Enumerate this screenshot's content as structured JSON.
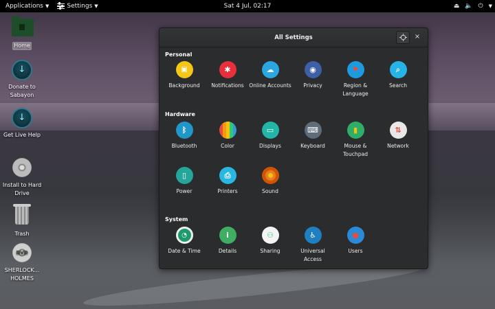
{
  "topbar": {
    "applications": "Applications",
    "settings": "Settings",
    "clock": "Sat  4 Jul, 02:17"
  },
  "desktop": [
    {
      "label": "Home",
      "icon": "folder-icon"
    },
    {
      "label": "Donate to Sabayon",
      "icon": "sabayon-icon"
    },
    {
      "label": "Get Live Help",
      "icon": "sabayon-icon"
    },
    {
      "label": "Install to Hard Drive",
      "icon": "disc-icon"
    },
    {
      "label": "Trash",
      "icon": "trash-icon"
    },
    {
      "label": "SHERLOCK... HOLMES",
      "icon": "dvd-icon"
    }
  ],
  "window": {
    "title": "All Settings",
    "close": "×"
  },
  "sections": {
    "personal": {
      "title": "Personal",
      "items": [
        {
          "label": "Background",
          "color": "#f5c518"
        },
        {
          "label": "Notifications",
          "color": "#e8303c"
        },
        {
          "label": "Online Accounts",
          "color": "#2aa6e0"
        },
        {
          "label": "Privacy",
          "color": "#3d5fa8"
        },
        {
          "label": "Region & Language",
          "color": "#1e9be0"
        },
        {
          "label": "Search",
          "color": "#27b3e8"
        }
      ]
    },
    "hardware": {
      "title": "Hardware",
      "items": [
        {
          "label": "Bluetooth",
          "color": "#2196c8"
        },
        {
          "label": "Color",
          "color": "#f0a030"
        },
        {
          "label": "Displays",
          "color": "#22b5a8"
        },
        {
          "label": "Keyboard",
          "color": "#5e6b78"
        },
        {
          "label": "Mouse & Touchpad",
          "color": "#2fae6a"
        },
        {
          "label": "Network",
          "color": "#4a90d0"
        },
        {
          "label": "Power",
          "color": "#26a69a"
        },
        {
          "label": "Printers",
          "color": "#29b6e0"
        },
        {
          "label": "Sound",
          "color": "#e67e22"
        }
      ]
    },
    "system": {
      "title": "System",
      "items": [
        {
          "label": "Date & Time",
          "color": "#1d9b6c"
        },
        {
          "label": "Details",
          "color": "#3fae63"
        },
        {
          "label": "Sharing",
          "color": "#f4f4f4"
        },
        {
          "label": "Universal Access",
          "color": "#1f7fc0"
        },
        {
          "label": "Users",
          "color": "#2a8ad8"
        }
      ]
    }
  }
}
